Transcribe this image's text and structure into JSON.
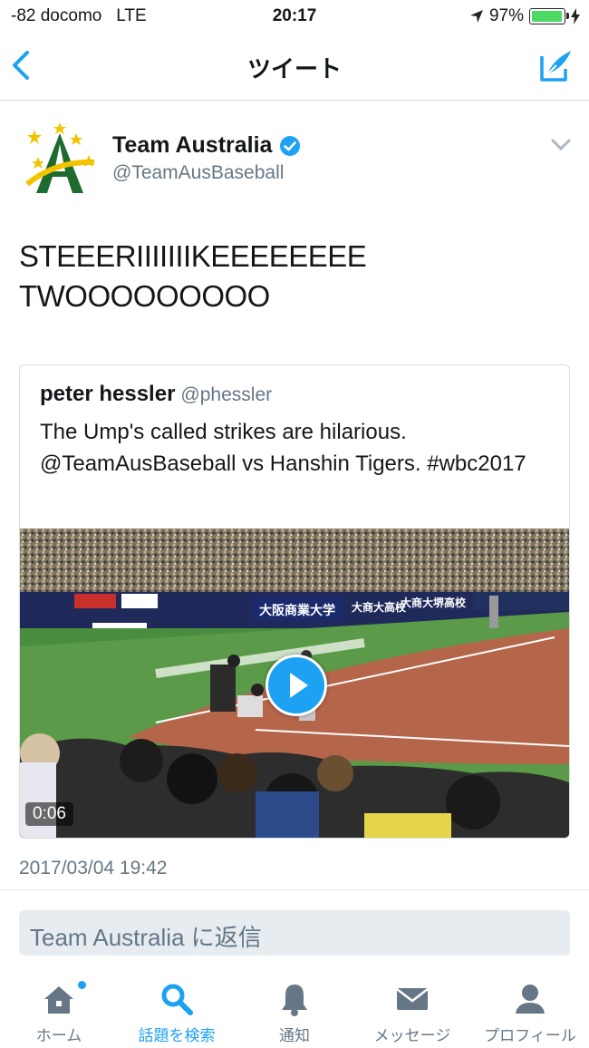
{
  "status_bar": {
    "carrier": "-82 docomo",
    "network": "LTE",
    "time": "20:17",
    "battery": "97%",
    "battery_level": 0.97
  },
  "nav": {
    "title": "ツイート"
  },
  "tweet": {
    "author_name": "Team Australia",
    "author_handle": "@TeamAusBaseball",
    "text_line1": "STEEERIIIIIIIKEEEEEEEE",
    "text_line2": "TWOOOOOOOOO",
    "quoted": {
      "name": "peter hessler",
      "handle": "@phessler",
      "text": "The Ump's called strikes are hilarious. @TeamAusBaseball vs Hanshin Tigers. #wbc2017",
      "video_duration": "0:06",
      "video_banner_main": "大阪商業大学",
      "video_banner_b": "大商大高校",
      "video_banner_c": "大商大堺高校"
    },
    "timestamp": "2017/03/04 19:42"
  },
  "reply": {
    "placeholder": "Team Australia に返信"
  },
  "tabs": [
    {
      "label": "ホーム",
      "icon": "home-icon"
    },
    {
      "label": "話題を検索",
      "icon": "search-icon"
    },
    {
      "label": "通知",
      "icon": "bell-icon"
    },
    {
      "label": "メッセージ",
      "icon": "mail-icon"
    },
    {
      "label": "プロフィール",
      "icon": "profile-icon"
    }
  ],
  "colors": {
    "accent": "#1da1f2",
    "secondary_text": "#657786",
    "verified": "#1da1f2"
  }
}
